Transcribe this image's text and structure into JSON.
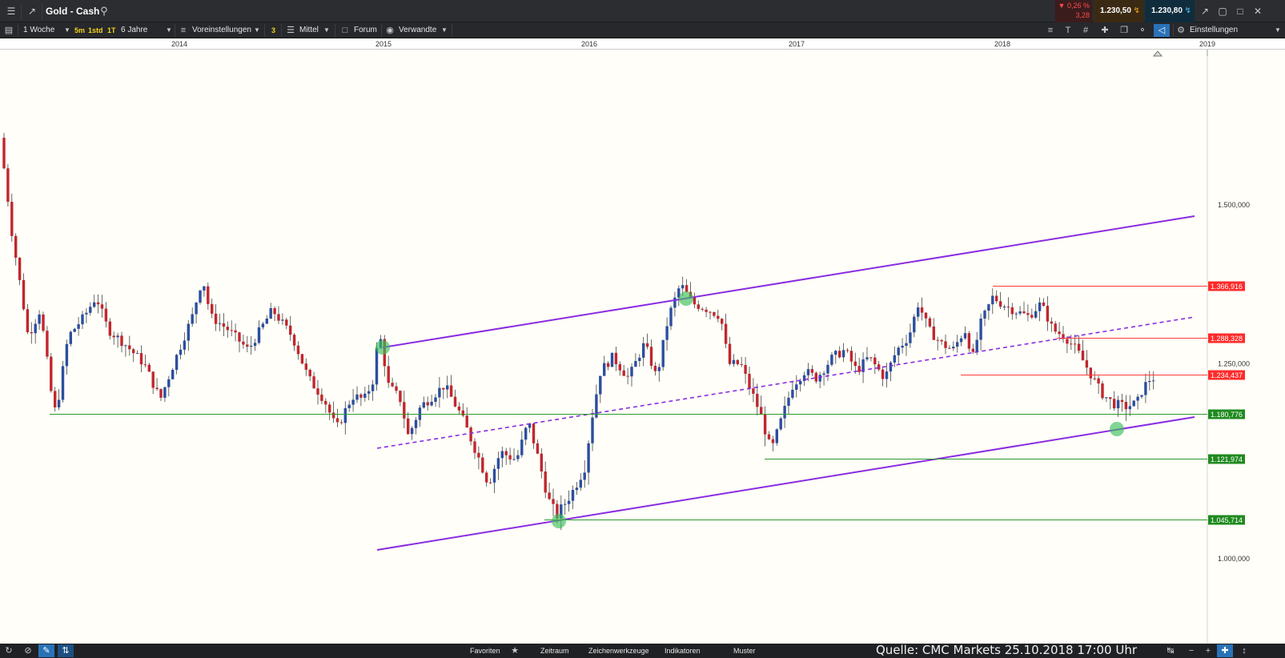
{
  "window": {
    "title": "Gold - Cash",
    "change_percent": "0,26 %",
    "change_abs": "3,28",
    "bid": "1.230,50",
    "ask": "1.230,80"
  },
  "toolbar": {
    "interval": "1 Woche",
    "quick_5m": "5m",
    "quick_1std": "1std",
    "quick_1t": "1T",
    "range": "6 Jahre",
    "presets": "Voreinstellungen",
    "line_width": "3",
    "style": "Mittel",
    "forum": "Forum",
    "related": "Verwandte",
    "settings": "Einstellungen"
  },
  "date_axis": {
    "years": [
      "2014",
      "2015",
      "2016",
      "2017",
      "2018",
      "2019"
    ]
  },
  "price_axis": {
    "labels": [
      "1.500,000",
      "1.250,000",
      "1.000,000"
    ]
  },
  "chart_data": {
    "type": "candlestick",
    "instrument": "Gold - Cash",
    "interval": "1 Woche",
    "x_range": [
      "2013",
      "2018-10"
    ],
    "y_scale": "log",
    "levels": [
      {
        "value": "1.366,916",
        "color": "#ff3b3b"
      },
      {
        "value": "1.288,328",
        "color": "#ff3b3b"
      },
      {
        "value": "1.234,437",
        "color": "#ff3b3b"
      },
      {
        "value": "1.180,776",
        "color": "#2e9a2e"
      },
      {
        "value": "1.121,974",
        "color": "#2e9a2e"
      },
      {
        "value": "1.045,714",
        "color": "#2e9a2e"
      }
    ]
  },
  "bottom": {
    "favorites": "Favoriten",
    "period": "Zeitraum",
    "drawing_tools": "Zeichenwerkzeuge",
    "indicators": "Indikatoren",
    "patterns": "Muster",
    "source": "Quelle: CMC Markets 25.10.2018 17:00 Uhr"
  },
  "colors": {
    "channel": "#8a2be2",
    "candle_up": "#2b4ea0",
    "candle_down": "#c0272d",
    "support": "#2e9a2e",
    "resistance": "#ff3b3b"
  }
}
